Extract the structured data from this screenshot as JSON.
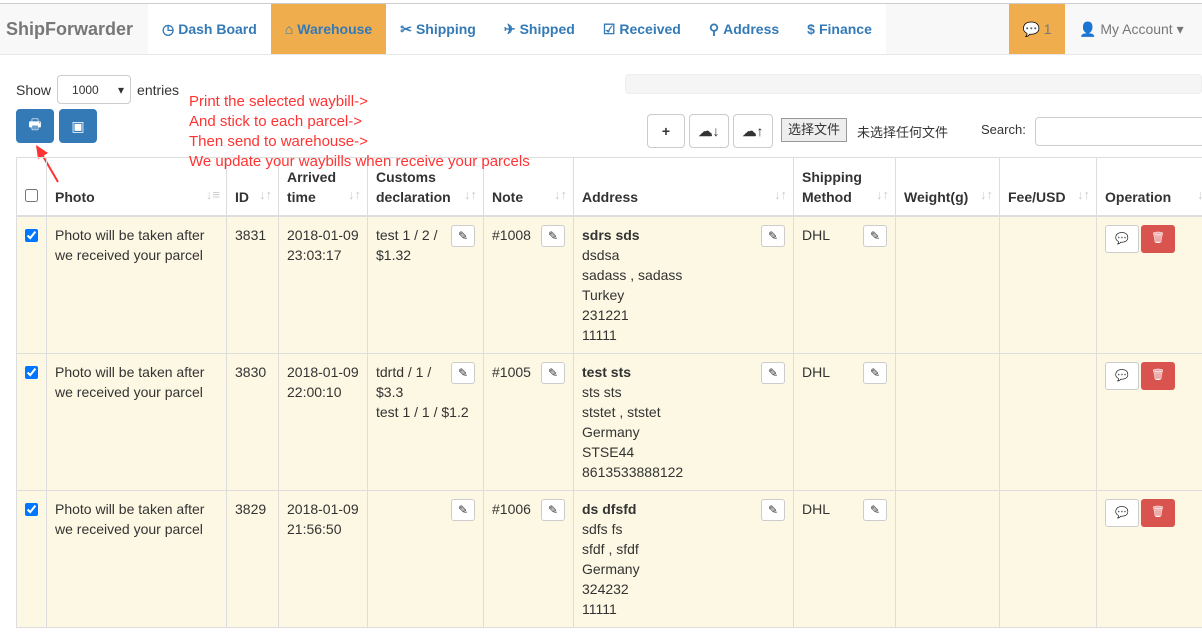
{
  "nav": {
    "brand": "ShipForwarder",
    "items": [
      {
        "label": "Dash Board",
        "icon": "dashboard-icon",
        "glyph": "◷"
      },
      {
        "label": "Warehouse",
        "icon": "home-icon",
        "glyph": "⌂",
        "active": true
      },
      {
        "label": "Shipping",
        "icon": "scissors-icon",
        "glyph": "✂"
      },
      {
        "label": "Shipped",
        "icon": "plane-icon",
        "glyph": "✈"
      },
      {
        "label": "Received",
        "icon": "calendar-check-icon",
        "glyph": "☑"
      },
      {
        "label": "Address",
        "icon": "map-marker-icon",
        "glyph": "⚲"
      },
      {
        "label": "Finance",
        "icon": "dollar-icon",
        "glyph": "$"
      }
    ],
    "messages": "1",
    "account": "My Account"
  },
  "toolbar": {
    "show": "Show",
    "entries": "entries",
    "page_size": "1000",
    "choose_file": "选择文件",
    "no_file": "未选择任何文件",
    "search_label": "Search:",
    "search_value": ""
  },
  "annotation": [
    "Print the selected waybill->",
    "And stick to each parcel->",
    "Then send to warehouse->",
    "We update your waybills when receive your parcels"
  ],
  "colors": {
    "accent": "#f0ad4e",
    "primary": "#337ab7",
    "danger": "#d9534f",
    "row": "#fcf8e3",
    "annotation": "#ff3333"
  },
  "table": {
    "headers": [
      "Photo",
      "ID",
      "Arrived time",
      "Customs declaration",
      "Note",
      "Address",
      "Shipping Method",
      "Weight(g)",
      "Fee/USD",
      "Operation"
    ],
    "rows": [
      {
        "checked": true,
        "photo": "Photo will be taken after we received your parcel",
        "id": "3831",
        "arrived": [
          "2018-01-09",
          "23:03:17"
        ],
        "customs": [
          "test 1 / 2 / $1.32"
        ],
        "note": "#1008",
        "address_name": "sdrs sds",
        "address": [
          "dsdsa",
          "sadass , sadass",
          "Turkey",
          "231221",
          "11111"
        ],
        "method": "DHL",
        "weight": "",
        "fee": ""
      },
      {
        "checked": true,
        "photo": "Photo will be taken after we received your parcel",
        "id": "3830",
        "arrived": [
          "2018-01-09",
          "22:00:10"
        ],
        "customs": [
          "tdrtd / 1 / $3.3",
          "test 1 / 1 / $1.2"
        ],
        "note": "#1005",
        "address_name": "test sts",
        "address": [
          "sts sts",
          "ststet , ststet",
          "Germany",
          "STSE44",
          "8613533888122"
        ],
        "method": "DHL",
        "weight": "",
        "fee": ""
      },
      {
        "checked": true,
        "photo": "Photo will be taken after we received your parcel",
        "id": "3829",
        "arrived": [
          "2018-01-09",
          "21:56:50"
        ],
        "customs": [],
        "note": "#1006",
        "address_name": "ds dfsfd",
        "address": [
          "sdfs fs",
          "sfdf , sfdf",
          "Germany",
          "324232",
          "11111"
        ],
        "method": "DHL",
        "weight": "",
        "fee": ""
      }
    ]
  }
}
